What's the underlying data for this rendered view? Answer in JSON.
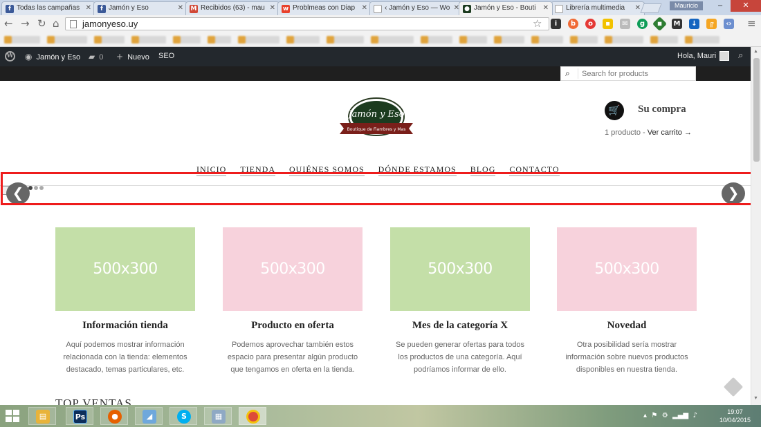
{
  "browser": {
    "tabs": [
      {
        "label": "Todas las campañas",
        "icon": "facebook-icon",
        "color": "#3b5998",
        "glyph": "f"
      },
      {
        "label": "Jamón y Eso",
        "icon": "facebook-icon",
        "color": "#3b5998",
        "glyph": "f"
      },
      {
        "label": "Recibidos (63) - mau",
        "icon": "gmail-icon",
        "color": "#d14836",
        "glyph": "M"
      },
      {
        "label": "Problmeas con Diap",
        "icon": "wix-icon",
        "color": "#e8412c",
        "glyph": "w"
      },
      {
        "label": "‹ Jamón y Eso — Wo",
        "icon": "page-icon",
        "color": "#bbbbbb",
        "glyph": ""
      },
      {
        "label": "Jamón y Eso - Bouti",
        "icon": "site-icon",
        "color": "#1c3b1f",
        "glyph": "●"
      },
      {
        "label": "Librería multimedia",
        "icon": "page-icon",
        "color": "#bbbbbb",
        "glyph": ""
      }
    ],
    "user_name": "Mauricio",
    "url": "jamonyeso.uy"
  },
  "adminbar": {
    "site_name": "Jamón y Eso",
    "comments_count": "0",
    "new_label": "Nuevo",
    "seo_label": "SEO",
    "greeting": "Hola, Mauri"
  },
  "header": {
    "search_placeholder": "Search for products",
    "logo_title": "Jamón y Eso",
    "logo_subtitle": "Boutique de Fiambres y Mas",
    "cart_title": "Su compra",
    "cart_count": "1 producto",
    "cart_separator": " - ",
    "cart_link": "Ver carrito →"
  },
  "nav": {
    "items": [
      "INICIO",
      "TIENDA",
      "QUIÉNES SOMOS",
      "DÓNDE ESTAMOS",
      "BLOG",
      "CONTACTO"
    ]
  },
  "slider": {
    "prev": "❮",
    "next": "❯"
  },
  "features": [
    {
      "placeholder": "500x300",
      "color": "green",
      "title": "Información tienda",
      "text": "Aquí podemos mostrar información relacionada con la tienda: elementos destacado, temas particulares, etc."
    },
    {
      "placeholder": "500x300",
      "color": "pink",
      "title": "Producto en oferta",
      "text": "Podemos aprovechar también estos espacio para presentar algún producto que tengamos en oferta en la tienda."
    },
    {
      "placeholder": "500x300",
      "color": "green",
      "title": "Mes de la categoría X",
      "text": "Se pueden generar ofertas para todos los productos de una categoría. Aquí podríamos informar de ello."
    },
    {
      "placeholder": "500x300",
      "color": "pink",
      "title": "Novedad",
      "text": "Otra posibilidad sería mostrar información sobre nuevos productos disponibles en nuestra tienda."
    }
  ],
  "section_title": "TOP VENTAS",
  "taskbar": {
    "time": "19:07",
    "date": "10/04/2015"
  }
}
